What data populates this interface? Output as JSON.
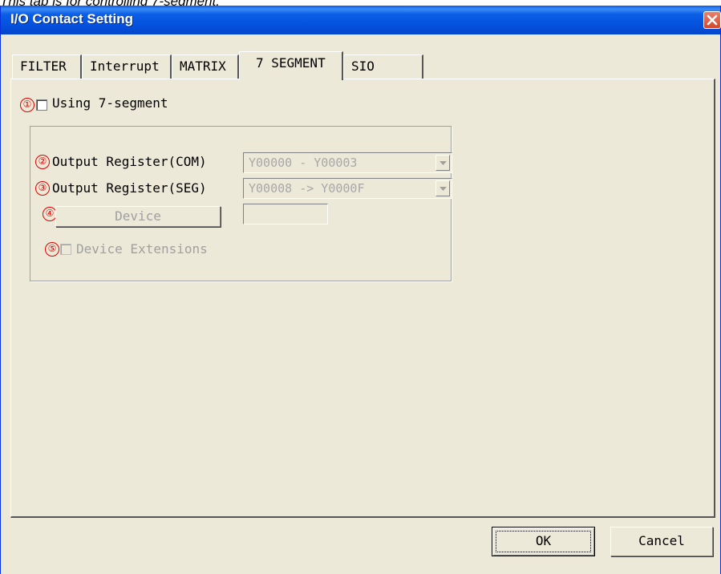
{
  "caption": "This tab is for controlling 7-segment.",
  "window": {
    "title": "I/O Contact Setting"
  },
  "tabs": [
    {
      "label": "FILTER"
    },
    {
      "label": "Interrupt"
    },
    {
      "label": "MATRIX"
    },
    {
      "label": "7 SEGMENT",
      "active": true
    },
    {
      "label": "SIO"
    }
  ],
  "markers": [
    "①",
    "②",
    "③",
    "④",
    "⑤"
  ],
  "using7seg": {
    "label": "Using 7-segment",
    "checked": false
  },
  "com": {
    "label": "Output Register(COM)",
    "value": "Y00000 - Y00003"
  },
  "seg": {
    "label": "Output Register(SEG)",
    "value": "Y00008 -> Y0000F"
  },
  "device": {
    "button_label": "Device",
    "value": ""
  },
  "extensions": {
    "label": "Device Extensions",
    "checked": false
  },
  "footer": {
    "ok_label": "OK",
    "cancel_label": "Cancel"
  },
  "colors": {
    "title_bar": "#0450dd",
    "dialog_bg": "#ece9d8",
    "marker": "#e00000",
    "close": "#d4472c"
  }
}
